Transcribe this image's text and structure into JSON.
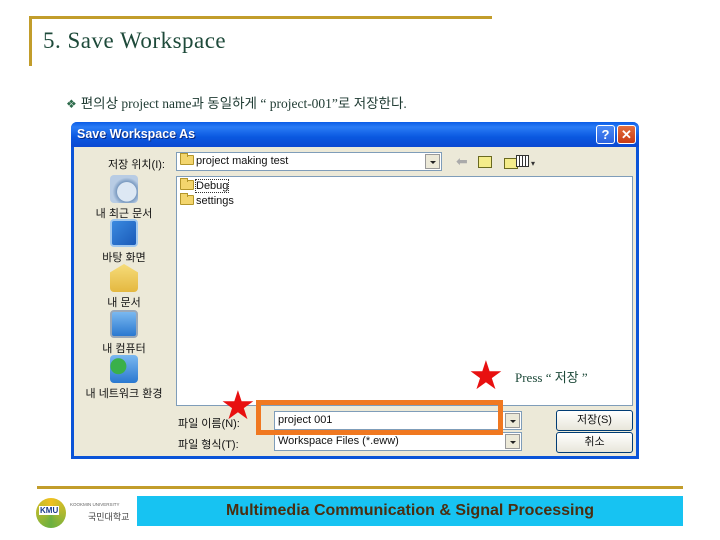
{
  "slide": {
    "title": "5. Save Workspace",
    "bullet_icon": "diamond-bullet-icon",
    "bullet_symbol": "❖",
    "bullet_text": "편의상 project name과 동일하게 “ project-001”로 저장한다."
  },
  "dialog": {
    "title": "Save Workspace As",
    "help_label": "?",
    "close_label": "✕",
    "save_in_label": "저장 위치(I):",
    "save_in_value": "project making test",
    "toolbar": {
      "back_symbol": "⬅",
      "view_menu_symbol": "▾"
    },
    "places": [
      {
        "label": "내 최근 문서",
        "icon": "recent-documents-icon"
      },
      {
        "label": "바탕 화면",
        "icon": "desktop-icon"
      },
      {
        "label": "내 문서",
        "icon": "my-documents-icon"
      },
      {
        "label": "내 컴퓨터",
        "icon": "my-computer-icon"
      },
      {
        "label": "내 네트워크 환경",
        "icon": "network-places-icon"
      }
    ],
    "files": [
      {
        "name": "Debug",
        "type": "folder",
        "selected": true
      },
      {
        "name": "settings",
        "type": "folder",
        "selected": false
      }
    ],
    "filename_label": "파일 이름(N):",
    "filename_value": "project 001",
    "filetype_label": "파일 형식(T):",
    "filetype_value": "Workspace Files (*.eww)",
    "save_button": "저장(S)",
    "cancel_button": "취소"
  },
  "annotations": {
    "star_symbol": "★",
    "press_text": "Press “ 저장 ”",
    "highlight_color": "#f07820",
    "star_color": "#e81010"
  },
  "footer": {
    "logo_abbr": "KMU",
    "logo_english": "KOOKMIN UNIVERSITY",
    "logo_korean": "국민대학교",
    "banner_text": "Multimedia Communication & Signal Processing",
    "banner_color": "#17c3f2",
    "accent_color": "#c29d2b"
  }
}
